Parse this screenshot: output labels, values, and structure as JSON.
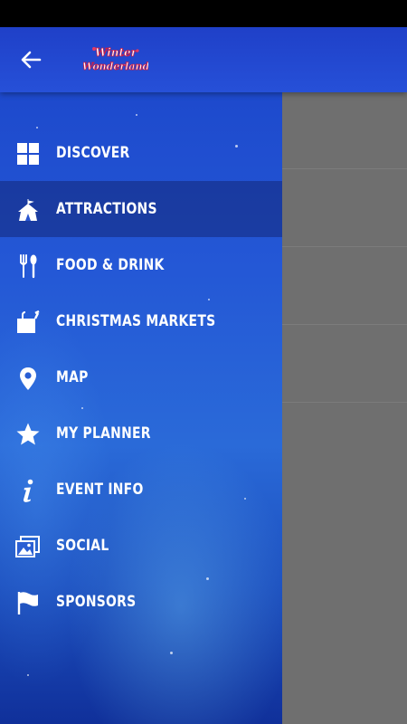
{
  "app": {
    "title": "Winter Wonderland",
    "logo_line1": "Winter",
    "logo_line2": "Wonderland"
  },
  "header": {
    "back_icon": "arrow-left-icon"
  },
  "menu": {
    "active_index": 1,
    "items": [
      {
        "label": "DISCOVER",
        "icon": "grid-icon"
      },
      {
        "label": "ATTRACTIONS",
        "icon": "circus-tent-icon"
      },
      {
        "label": "FOOD & DRINK",
        "icon": "fork-spoon-icon"
      },
      {
        "label": "CHRISTMAS MARKETS",
        "icon": "shopping-bag-icon"
      },
      {
        "label": "MAP",
        "icon": "map-pin-icon"
      },
      {
        "label": "MY PLANNER",
        "icon": "star-icon"
      },
      {
        "label": "EVENT INFO",
        "icon": "info-icon"
      },
      {
        "label": "SOCIAL",
        "icon": "photos-icon"
      },
      {
        "label": "SPONSORS",
        "icon": "flag-icon"
      }
    ]
  },
  "colors": {
    "drawer_top": "#1b44c9",
    "drawer_mid": "#2a6ad8",
    "active_row": "#1a2f86",
    "scrim": "#6f6f6f",
    "text": "#ffffff"
  }
}
